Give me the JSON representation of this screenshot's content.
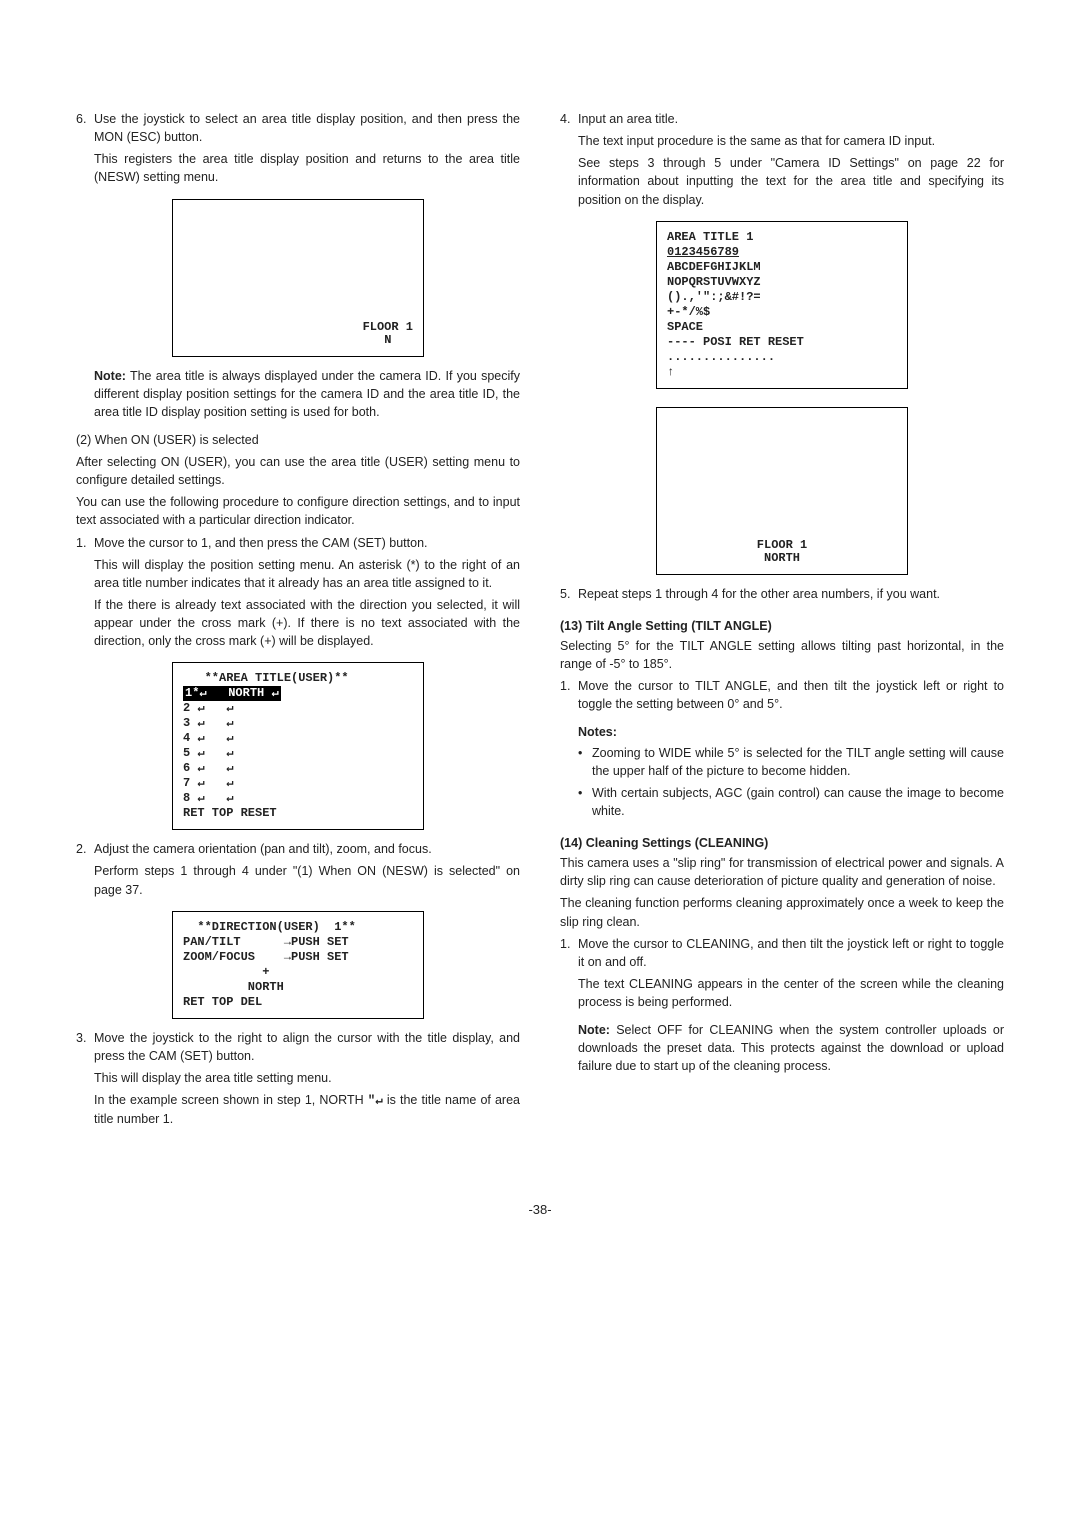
{
  "left": {
    "step6": {
      "num": "6.",
      "l1": "Use the joystick to select an area title display position, and then press the MON (ESC) button.",
      "l2": "This registers the area title display position and returns to the area title (NESW) setting menu."
    },
    "screen1": {
      "l1": "FLOOR 1",
      "l2": "N"
    },
    "note1": {
      "label": "Note:",
      "text": " The area title is always displayed under the camera ID. If you specify different display position settings for the camera ID and the area title ID, the area title ID display position setting is used for both."
    },
    "h2": "(2) When ON (USER) is selected",
    "p2a": "After selecting ON (USER), you can use the area title (USER) setting menu to configure detailed settings.",
    "p2b": "You can use the following procedure to configure direction settings, and to input text associated with a particular direction indicator.",
    "step1": {
      "num": "1.",
      "l1": "Move the cursor to 1, and then press the CAM (SET) button.",
      "l2": "This will display the position setting menu. An asterisk (*) to the right of an area title number indicates that it already has an area title assigned to it.",
      "l3": "If the there is already text associated with the direction you selected, it will appear under the cross mark (+). If there is no text associated with the direction, only the cross mark (+) will be displayed."
    },
    "screen2": [
      "   **AREA TITLE(USER)**",
      "1*↵   NORTH ↵",
      "2 ↵   ↵",
      "3 ↵   ↵",
      "4 ↵   ↵",
      "5 ↵   ↵",
      "6 ↵   ↵",
      "7 ↵   ↵",
      "8 ↵   ↵",
      "",
      "",
      "RET TOP RESET"
    ],
    "step2": {
      "num": "2.",
      "l1": "Adjust the camera orientation (pan and tilt), zoom, and focus.",
      "l2": "Perform steps 1 through 4 under \"(1) When ON (NESW) is selected\" on page 37."
    },
    "screen3": [
      "  **DIRECTION(USER)  1**",
      "PAN/TILT      →PUSH SET",
      "ZOOM/FOCUS    →PUSH SET",
      "",
      "",
      "           +",
      "         NORTH",
      "",
      "",
      "",
      "RET TOP DEL"
    ],
    "step3": {
      "num": "3.",
      "l1": "Move the joystick to the right to align the cursor with the title display, and press the CAM (SET) button.",
      "l2": "This will display the area title setting menu.",
      "l3a": "In the example screen shown in step 1, NORTH ",
      "l3b": " is the title name of area title number 1."
    }
  },
  "right": {
    "step4": {
      "num": "4.",
      "l1": "Input an area title.",
      "l2": "The text input procedure is the same as that for camera ID input.",
      "l3": "See steps 3 through 5 under \"Camera ID Settings\" on page 22 for information about inputting the text for the area title and specifying its position on the display."
    },
    "screen4": [
      "AREA TITLE 1",
      "0123456789",
      "ABCDEFGHIJKLM",
      "NOPQRSTUVWXYZ",
      "().,'\":;&#!?=",
      "+-*/%$",
      "",
      "SPACE",
      "---- POSI RET RESET",
      "",
      "...............",
      "↑"
    ],
    "screen5": {
      "l1": "FLOOR 1",
      "l2": "NORTH"
    },
    "step5": {
      "num": "5.",
      "text": "Repeat steps 1 through 4 for the other area numbers, if you want."
    },
    "h13": "(13) Tilt Angle Setting (TILT ANGLE)",
    "p13a": "Selecting 5° for the TILT ANGLE setting allows tilting past horizontal, in the range of -5° to 185°.",
    "step13_1": {
      "num": "1.",
      "text": "Move the cursor to TILT ANGLE, and then tilt the joystick left or right to toggle the setting between 0° and 5°."
    },
    "notes": {
      "label": "Notes:",
      "b1": "Zooming to WIDE while 5° is selected for the TILT angle setting will cause the upper half of the picture to become hidden.",
      "b2": "With certain subjects, AGC (gain control) can cause the image to become white."
    },
    "h14": "(14) Cleaning Settings (CLEANING)",
    "p14a": "This camera uses a \"slip ring\" for transmission of electrical power and signals. A dirty slip ring can cause deterioration of picture quality and generation of noise.",
    "p14b": "The cleaning function performs cleaning approximately once a week to keep the slip ring clean.",
    "step14_1": {
      "num": "1.",
      "l1": "Move the cursor to CLEANING, and then tilt the joystick left or right to toggle it on and off.",
      "l2": "The text CLEANING appears in the center of the screen while the cleaning process is being performed."
    },
    "note2": {
      "label": "Note:",
      "text": " Select OFF for CLEANING when the system controller uploads or downloads the preset data. This protects against the download or upload failure due to start up of the cleaning process."
    }
  },
  "pagenum": "-38-"
}
